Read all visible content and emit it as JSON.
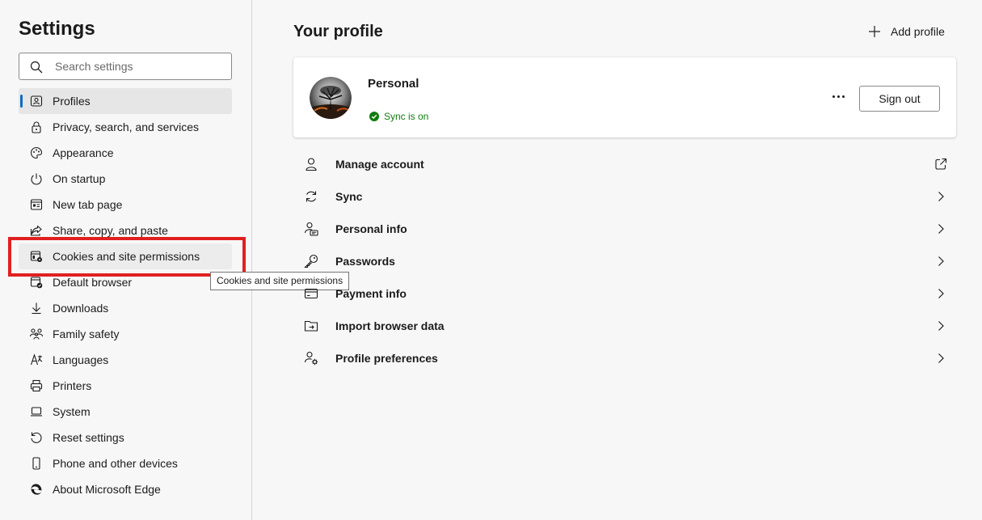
{
  "sidebar": {
    "title": "Settings",
    "search_placeholder": "Search settings",
    "items": [
      {
        "label": "Profiles",
        "icon": "profile-icon"
      },
      {
        "label": "Privacy, search, and services",
        "icon": "lock-icon"
      },
      {
        "label": "Appearance",
        "icon": "palette-icon"
      },
      {
        "label": "On startup",
        "icon": "power-icon"
      },
      {
        "label": "New tab page",
        "icon": "new-tab-icon"
      },
      {
        "label": "Share, copy, and paste",
        "icon": "share-icon"
      },
      {
        "label": "Cookies and site permissions",
        "icon": "cookies-icon"
      },
      {
        "label": "Default browser",
        "icon": "default-browser-icon"
      },
      {
        "label": "Downloads",
        "icon": "download-icon"
      },
      {
        "label": "Family safety",
        "icon": "family-icon"
      },
      {
        "label": "Languages",
        "icon": "languages-icon"
      },
      {
        "label": "Printers",
        "icon": "printer-icon"
      },
      {
        "label": "System",
        "icon": "laptop-icon"
      },
      {
        "label": "Reset settings",
        "icon": "reset-icon"
      },
      {
        "label": "Phone and other devices",
        "icon": "phone-icon"
      },
      {
        "label": "About Microsoft Edge",
        "icon": "edge-icon"
      }
    ]
  },
  "tooltip": "Cookies and site permissions",
  "main": {
    "title": "Your profile",
    "add_profile": "Add profile",
    "profile": {
      "name": "Personal",
      "sync_status": "Sync is on",
      "sign_out": "Sign out"
    },
    "rows": [
      {
        "label": "Manage account",
        "icon": "person-icon",
        "trail": "external-link-icon"
      },
      {
        "label": "Sync",
        "icon": "sync-icon",
        "trail": "chevron-right-icon"
      },
      {
        "label": "Personal info",
        "icon": "personal-info-icon",
        "trail": "chevron-right-icon"
      },
      {
        "label": "Passwords",
        "icon": "key-icon",
        "trail": "chevron-right-icon"
      },
      {
        "label": "Payment info",
        "icon": "credit-card-icon",
        "trail": "chevron-right-icon"
      },
      {
        "label": "Import browser data",
        "icon": "import-icon",
        "trail": "chevron-right-icon"
      },
      {
        "label": "Profile preferences",
        "icon": "profile-preferences-icon",
        "trail": "chevron-right-icon"
      }
    ]
  },
  "colors": {
    "accent": "#0f6cbd",
    "highlight_box": "#e02020",
    "sync_green": "#107c10"
  }
}
